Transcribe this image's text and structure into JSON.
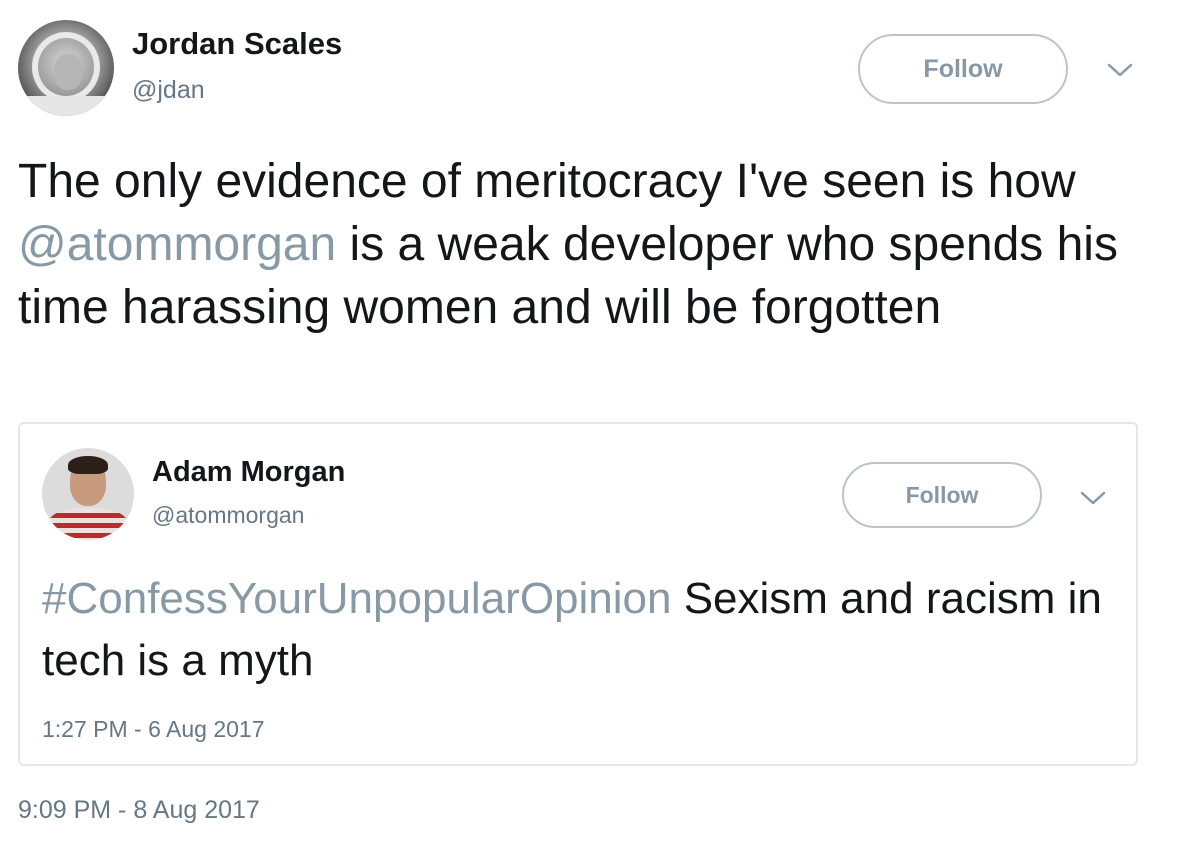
{
  "tweet": {
    "author_name": "Jordan Scales",
    "author_handle": "@jdan",
    "follow_label": "Follow",
    "text_before_mention": "The only evidence of meritocracy I've seen is how ",
    "mention": "@atommorgan",
    "text_after_mention": " is a weak developer who spends his time harassing women and will be forgotten",
    "timestamp": "9:09 PM - 8 Aug 2017"
  },
  "quoted_tweet": {
    "author_name": "Adam Morgan",
    "author_handle": "@atommorgan",
    "follow_label": "Follow",
    "hashtag": "#ConfessYourUnpopularOpinion",
    "text_after_hashtag": " Sexism and racism in tech is a myth",
    "timestamp": "1:27 PM - 6 Aug 2017"
  },
  "icons": {
    "menu_chevron": "chevron-down-icon"
  },
  "colors": {
    "text_primary": "#14171a",
    "text_secondary": "#657786",
    "link_muted": "#8899a6",
    "button_border": "#b9c4cd",
    "card_border": "#e1e8ed"
  }
}
